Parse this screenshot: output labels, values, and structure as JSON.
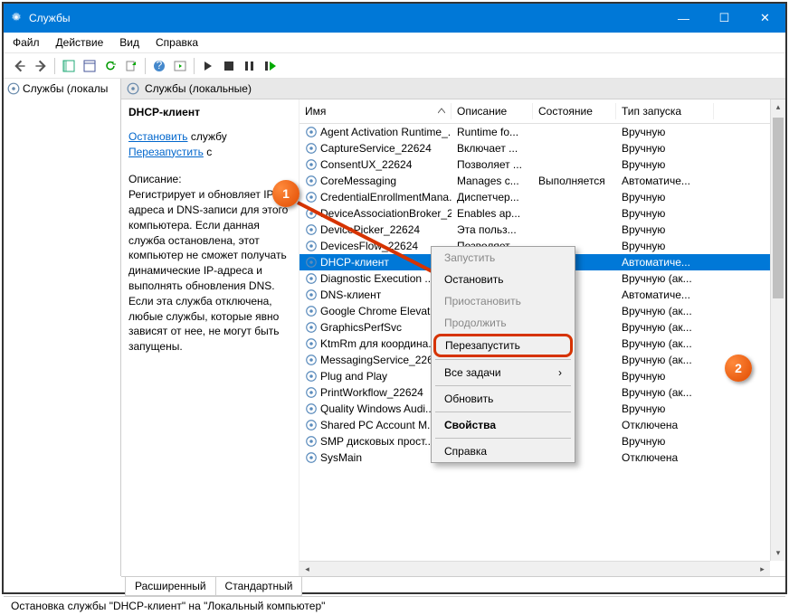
{
  "window": {
    "title": "Службы",
    "min": "—",
    "max": "☐",
    "close": "✕"
  },
  "menubar": [
    "Файл",
    "Действие",
    "Вид",
    "Справка"
  ],
  "leftpane": {
    "node": "Службы (локалы"
  },
  "rp_header": "Службы (локальные)",
  "info": {
    "heading": "DHCP-клиент",
    "link_stop": "Остановить",
    "link_stop_rest": " службу",
    "link_restart": "Перезапустить",
    "link_restart_rest": " с",
    "desc_label": "Описание:",
    "desc": "Регистрирует и обновляет IP адреса и DNS-записи для этого компьютера. Если данная служба остановлена, этот компьютер не сможет получать динамические IP-адреса и выполнять обновления DNS. Если эта служба отключена, любые службы, которые явно зависят от нее, не могут быть запущены."
  },
  "cols": {
    "name": "Имя",
    "desc": "Описание",
    "state": "Состояние",
    "start": "Тип запуска"
  },
  "rows": [
    {
      "n": "Agent Activation Runtime_...",
      "d": "Runtime fo...",
      "s": "",
      "t": "Вручную"
    },
    {
      "n": "CaptureService_22624",
      "d": "Включает ...",
      "s": "",
      "t": "Вручную"
    },
    {
      "n": "ConsentUX_22624",
      "d": "Позволяет ...",
      "s": "",
      "t": "Вручную"
    },
    {
      "n": "CoreMessaging",
      "d": "Manages c...",
      "s": "Выполняется",
      "t": "Автоматиче..."
    },
    {
      "n": "CredentialEnrollmentMana...",
      "d": "Диспетчер...",
      "s": "",
      "t": "Вручную"
    },
    {
      "n": "DeviceAssociationBroker_22...",
      "d": "Enables ap...",
      "s": "",
      "t": "Вручную"
    },
    {
      "n": "DevicePicker_22624",
      "d": "Эта польз...",
      "s": "",
      "t": "Вручную"
    },
    {
      "n": "DevicesFlow_22624",
      "d": "Позволяет ...",
      "s": "",
      "t": "Вручную"
    },
    {
      "n": "DHCP-клиент",
      "d": "",
      "s": "ется",
      "t": "Автоматиче...",
      "sel": true
    },
    {
      "n": "Diagnostic Execution ...",
      "d": "",
      "s": "",
      "t": "Вручную (ак..."
    },
    {
      "n": "DNS-клиент",
      "d": "",
      "s": "ется",
      "t": "Автоматиче..."
    },
    {
      "n": "Google Chrome Elevat...",
      "d": "",
      "s": "",
      "t": "Вручную (ак..."
    },
    {
      "n": "GraphicsPerfSvc",
      "d": "",
      "s": "",
      "t": "Вручную (ак..."
    },
    {
      "n": "KtmRm для координа...",
      "d": "",
      "s": "",
      "t": "Вручную (ак..."
    },
    {
      "n": "MessagingService_226...",
      "d": "",
      "s": "",
      "t": "Вручную (ак..."
    },
    {
      "n": "Plug and Play",
      "d": "",
      "s": "ется",
      "t": "Вручную"
    },
    {
      "n": "PrintWorkflow_22624",
      "d": "",
      "s": "",
      "t": "Вручную (ак..."
    },
    {
      "n": "Quality Windows Audi...",
      "d": "",
      "s": "",
      "t": "Вручную"
    },
    {
      "n": "Shared PC Account M...",
      "d": "",
      "s": "",
      "t": "Отключена"
    },
    {
      "n": "SMP дисковых прост...",
      "d": "",
      "s": "",
      "t": "Вручную"
    },
    {
      "n": "SysMain",
      "d": "",
      "s": "ется",
      "t": "Отключена"
    }
  ],
  "ctx": {
    "start": "Запустить",
    "stop": "Остановить",
    "pause": "Приостановить",
    "resume": "Продолжить",
    "restart": "Перезапустить",
    "alltasks": "Все задачи",
    "refresh": "Обновить",
    "props": "Свойства",
    "help": "Справка"
  },
  "tabs": {
    "ext": "Расширенный",
    "std": "Стандартный"
  },
  "status": "Остановка службы \"DHCP-клиент\" на \"Локальный компьютер\"",
  "markers": {
    "m1": "1",
    "m2": "2"
  }
}
